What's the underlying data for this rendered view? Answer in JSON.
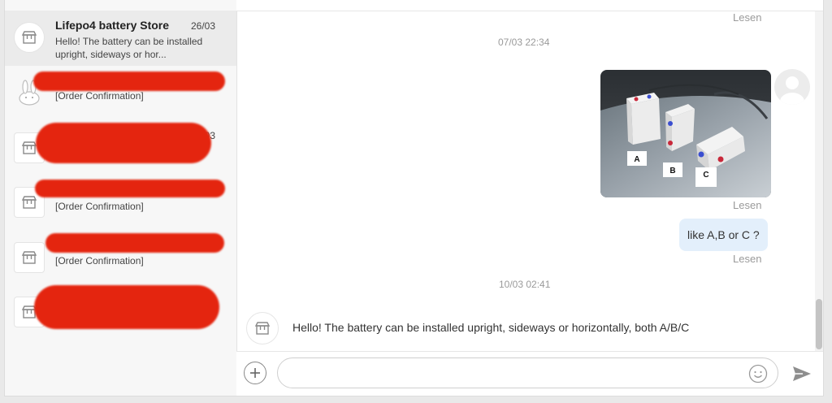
{
  "conversations": [
    {
      "name": "Lifepo4 battery Store",
      "date": "26/03",
      "preview": "Hello! The battery can be installed upright, sideways or hor...",
      "avatar_icon": "store-icon",
      "active": true
    },
    {
      "name": "",
      "date": "",
      "preview": "[Order Confirmation]",
      "avatar_icon": "bunny-avatar-icon",
      "redacted": true
    },
    {
      "name": "",
      "date": "19/03",
      "preview": "",
      "avatar_icon": "store-icon",
      "redacted": true
    },
    {
      "name": "",
      "date": "",
      "preview": "[Order Confirmation]",
      "avatar_icon": "store-icon",
      "redacted": true
    },
    {
      "name": "",
      "date": "",
      "preview": "[Order Confirmation]",
      "avatar_icon": "store-icon",
      "redacted": true
    },
    {
      "name": "",
      "date": "",
      "preview": "",
      "avatar_icon": "store-icon",
      "redacted": true
    }
  ],
  "chat": {
    "read_top": "Lesen",
    "timestamp_1": "07/03 22:34",
    "photo_labels": [
      "A",
      "B",
      "C"
    ],
    "read_after_photo": "Lesen",
    "outgoing_message": "like A,B or C ?",
    "read_after_message": "Lesen",
    "timestamp_2": "10/03 02:41",
    "incoming_message": "Hello! The battery can be installed upright, sideways or horizontally, both A/B/C"
  },
  "input": {
    "value": "",
    "placeholder": ""
  },
  "colors": {
    "accent_bubble": "#e3effb",
    "redaction": "#e4250f",
    "active_row": "#ebebeb"
  }
}
